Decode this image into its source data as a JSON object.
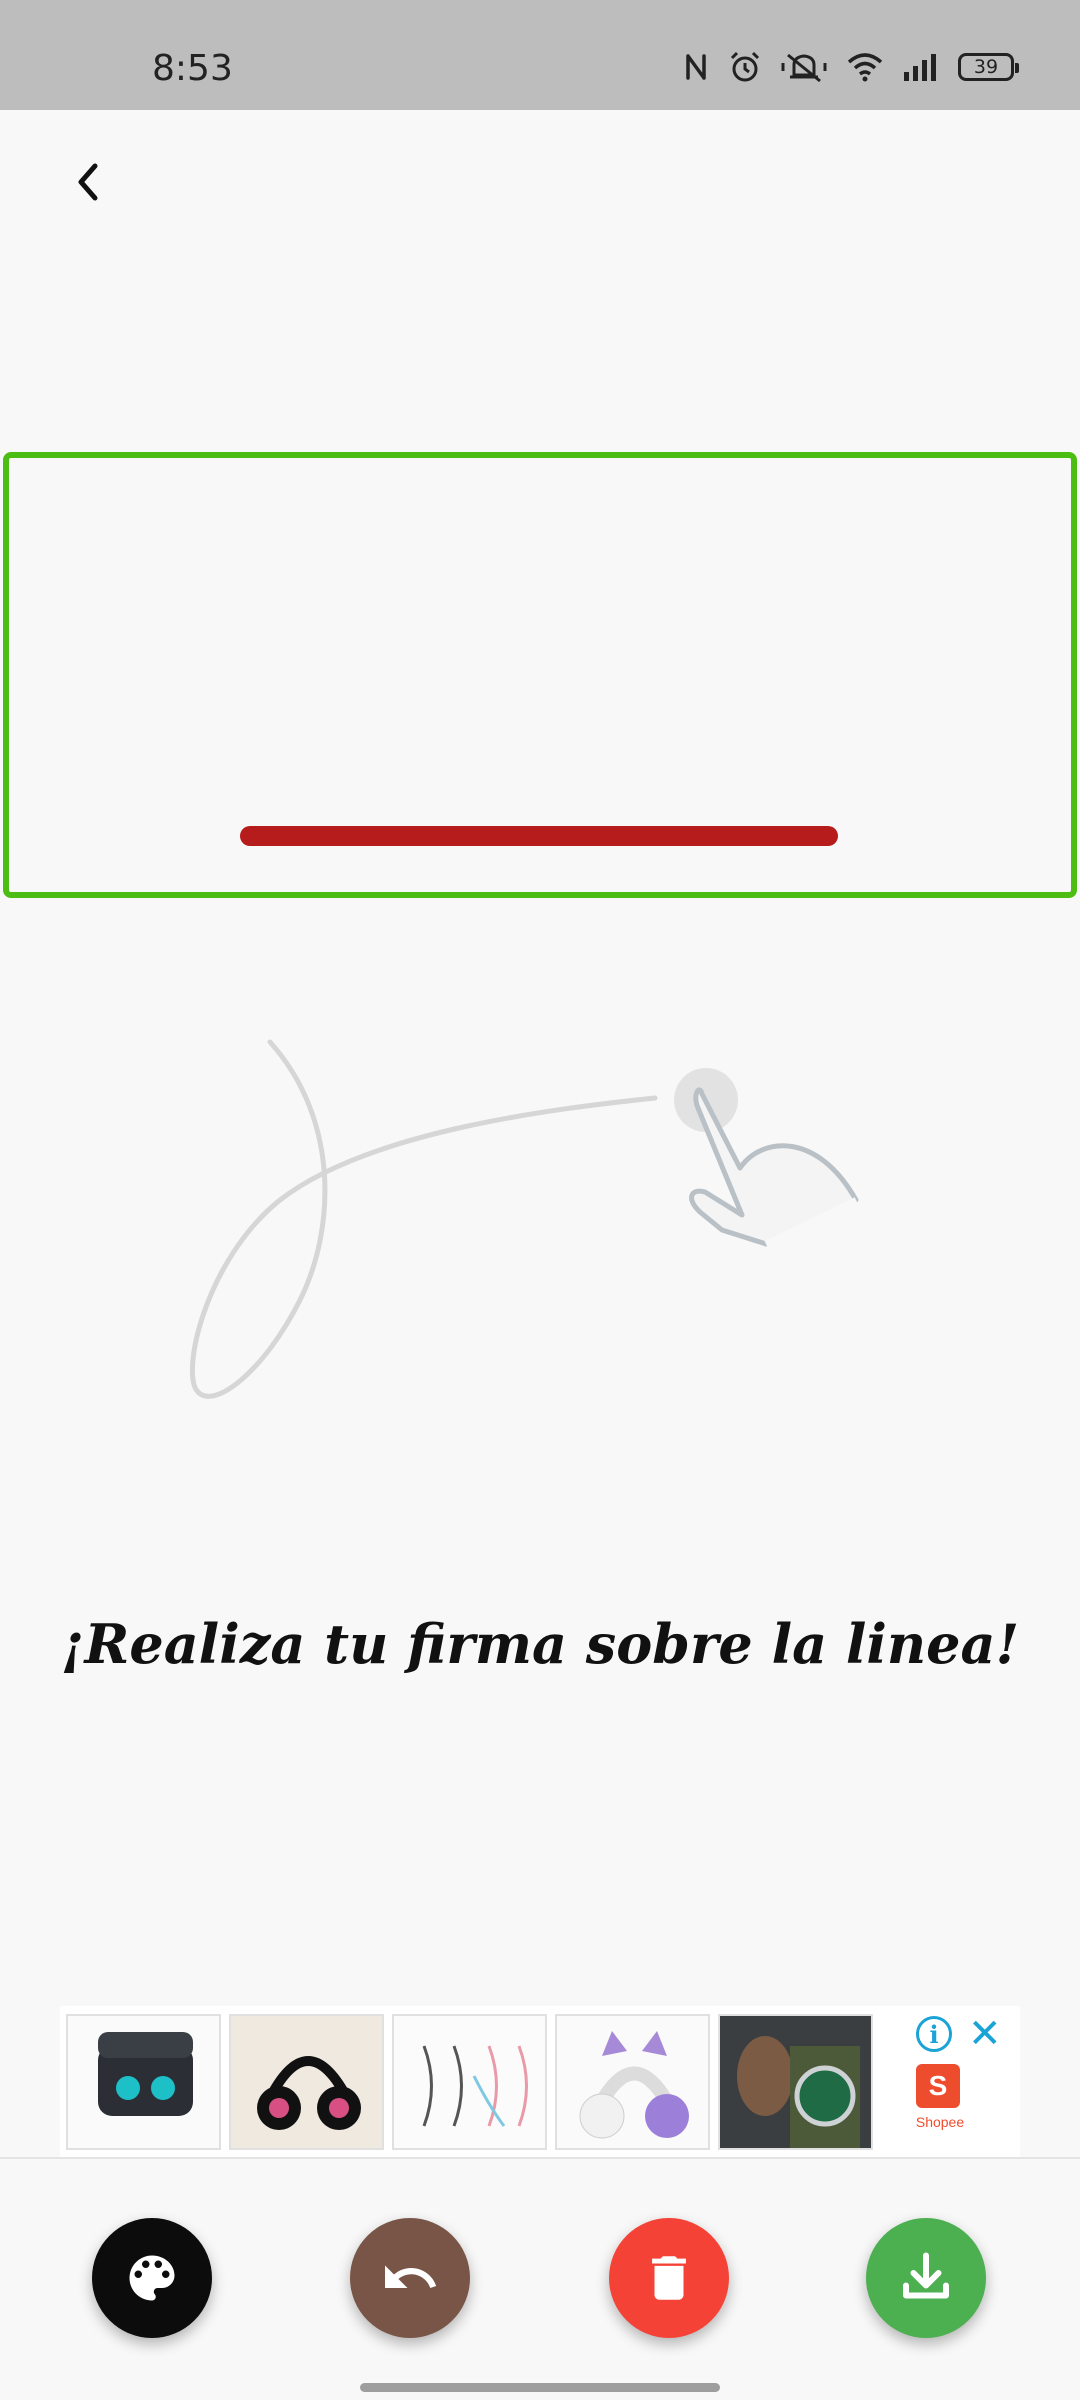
{
  "status_bar": {
    "time": "8:53",
    "battery": "39",
    "icons": [
      "nfc-icon",
      "alarm-icon",
      "mute-icon",
      "wifi-icon",
      "signal-icon",
      "battery-icon"
    ]
  },
  "header": {
    "back_icon": "chevron-left-icon"
  },
  "signature": {
    "border_color": "#4cbd12",
    "line_color": "#b71c1c"
  },
  "instruction": "¡Realiza tu firma sobre la linea!",
  "ad": {
    "products": [
      "earbuds",
      "headphones",
      "cables",
      "cat-ear-headphones",
      "watch"
    ],
    "brand": "Shopee",
    "brand_initial": "S",
    "info_label": "i",
    "close_label": "✕"
  },
  "actions": [
    {
      "name": "palette",
      "icon": "palette-icon",
      "color": "#0c0c0c"
    },
    {
      "name": "undo",
      "icon": "undo-icon",
      "color": "#795548"
    },
    {
      "name": "delete",
      "icon": "trash-icon",
      "color": "#f44336"
    },
    {
      "name": "save",
      "icon": "download-icon",
      "color": "#4caf50"
    }
  ]
}
